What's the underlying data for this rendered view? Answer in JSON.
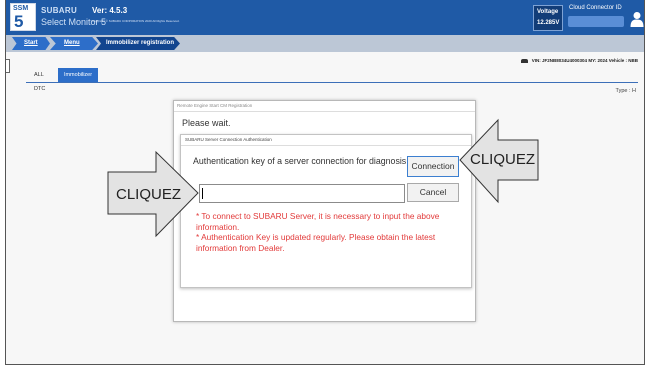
{
  "app": {
    "brand_line1": "SUBARU",
    "brand_line2": "Select Monitor 5",
    "logo_text_small": "SSM",
    "logo_text_big": "5",
    "version": "Ver: 4.5.3",
    "copyright": "Copyright © SUBARU CORPORATION 2020 All Rights Reserved.",
    "voltage_label": "Voltage",
    "voltage_value": "12.285V",
    "cloud_connector_label": "Cloud Connector ID"
  },
  "breadcrumb": {
    "start": "Start",
    "menu": "Menu",
    "current": "Immobilizer registration"
  },
  "vehicle_info": "VIN: JF2NB8034U4000304  MY: 2024  Vehicle : NBB",
  "tabs": [
    {
      "label": "ALL DTC"
    },
    {
      "label": "Immobilizer"
    }
  ],
  "type_label": "Type : H",
  "outer_dialog": {
    "title": "Remote Engine Start CM Registration",
    "message": "Please wait."
  },
  "auth_dialog": {
    "title": "SUBARU Server Connection Authentication",
    "label": "Authentication key of a server connection for diagnosis",
    "connection_button": "Connection",
    "cancel_button": "Cancel",
    "key_value": "",
    "note1_line1": "* To connect to SUBARU Server, it is necessary to input the above",
    "note1_line2": "information.",
    "note2_line1": "* Authentication Key is updated regularly. Please obtain the latest",
    "note2_line2": "information from Dealer."
  },
  "callouts": {
    "left": "CLIQUEZ",
    "right": "CLIQUEZ"
  },
  "colors": {
    "titlebar": "#1f5aa6",
    "breadcrumb_bar": "#bcc7d6",
    "active_tab": "#2d6ec9",
    "note_text": "#e23a3a",
    "callout_fill": "#e3e3e3"
  },
  "icons": [
    "user-icon",
    "car-icon",
    "subaru-logo"
  ]
}
